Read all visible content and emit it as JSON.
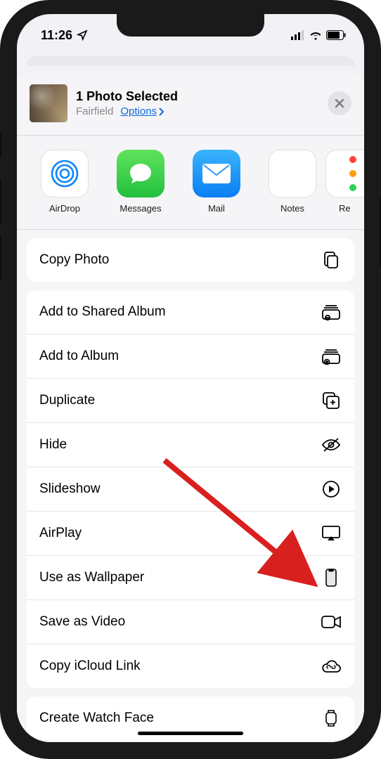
{
  "status": {
    "time": "11:26"
  },
  "header": {
    "title": "1 Photo Selected",
    "location": "Fairfield",
    "options_label": "Options"
  },
  "apps": [
    {
      "label": "AirDrop"
    },
    {
      "label": "Messages"
    },
    {
      "label": "Mail"
    },
    {
      "label": "Notes"
    },
    {
      "label": "Re"
    }
  ],
  "actions_primary": [
    {
      "label": "Copy Photo",
      "icon": "copy"
    }
  ],
  "actions_secondary": [
    {
      "label": "Add to Shared Album",
      "icon": "shared-album"
    },
    {
      "label": "Add to Album",
      "icon": "add-album"
    },
    {
      "label": "Duplicate",
      "icon": "duplicate"
    },
    {
      "label": "Hide",
      "icon": "hide"
    },
    {
      "label": "Slideshow",
      "icon": "play-circle"
    },
    {
      "label": "AirPlay",
      "icon": "airplay"
    },
    {
      "label": "Use as Wallpaper",
      "icon": "phone"
    },
    {
      "label": "Save as Video",
      "icon": "video"
    },
    {
      "label": "Copy iCloud Link",
      "icon": "cloud-link"
    }
  ],
  "actions_tertiary": [
    {
      "label": "Create Watch Face",
      "icon": "watch"
    }
  ]
}
